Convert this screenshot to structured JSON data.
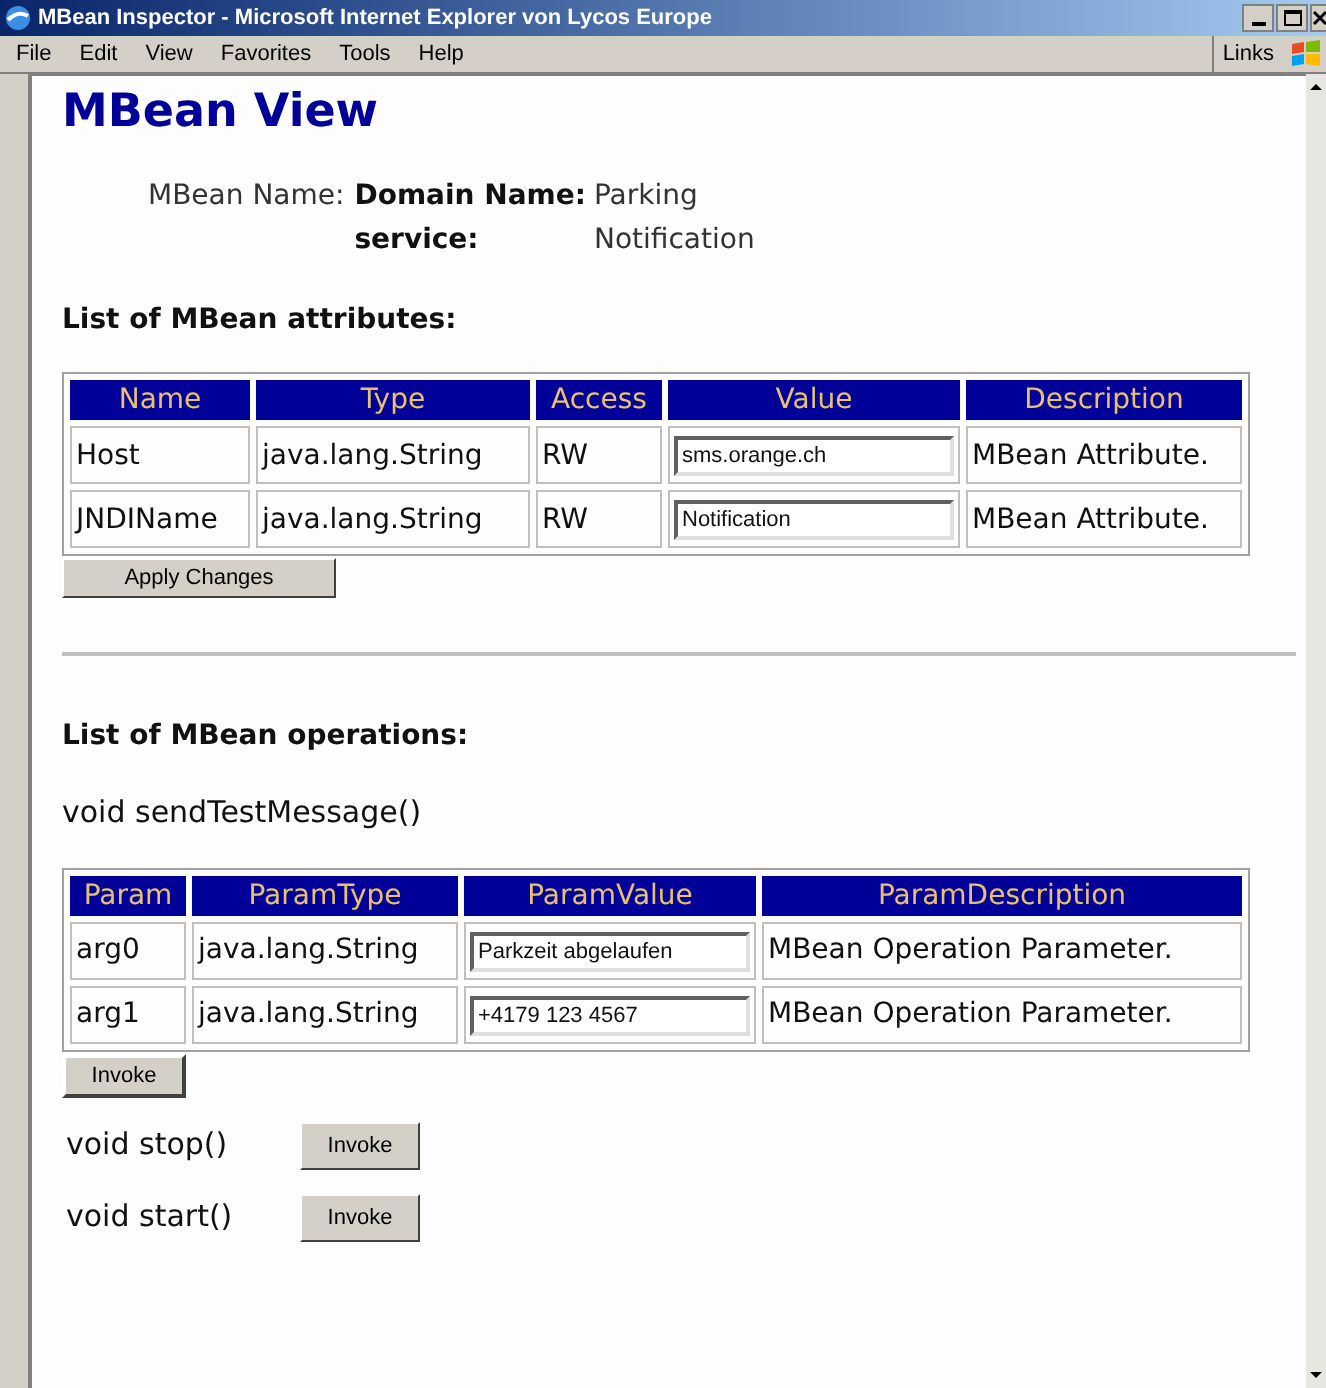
{
  "window": {
    "title": "MBean Inspector - Microsoft Internet Explorer von Lycos Europe"
  },
  "menu": [
    "File",
    "Edit",
    "View",
    "Favorites",
    "Tools",
    "Help"
  ],
  "links_label": "Links",
  "heading": "MBean View",
  "mbean_name": {
    "label": "MBean Name:",
    "properties": [
      {
        "key": "Domain Name:",
        "value": "Parking"
      },
      {
        "key": "service:",
        "value": "Notification"
      }
    ]
  },
  "attributes": {
    "title": "List of MBean attributes:",
    "columns": [
      "Name",
      "Type",
      "Access",
      "Value",
      "Description"
    ],
    "rows": [
      {
        "name": "Host",
        "type": "java.lang.String",
        "access": "RW",
        "value": "sms.orange.ch",
        "description": "MBean Attribute."
      },
      {
        "name": "JNDIName",
        "type": "java.lang.String",
        "access": "RW",
        "value": "Notification",
        "description": "MBean Attribute."
      }
    ],
    "button": "Apply Changes"
  },
  "operations": {
    "title": "List of MBean operations:",
    "items": [
      {
        "kind": "params",
        "signature": "void sendTestMessage()",
        "columns": [
          "Param",
          "ParamType",
          "ParamValue",
          "ParamDescription"
        ],
        "rows": [
          {
            "param": "arg0",
            "type": "java.lang.String",
            "value": "Parkzeit abgelaufen",
            "description": "MBean Operation Parameter."
          },
          {
            "param": "arg1",
            "type": "java.lang.String",
            "value": "+4179 123 4567",
            "description": "MBean Operation Parameter."
          }
        ],
        "button": "Invoke"
      },
      {
        "kind": "simple",
        "signature": "void stop()",
        "button": "Invoke"
      },
      {
        "kind": "simple",
        "signature": "void start()",
        "button": "Invoke"
      }
    ]
  }
}
